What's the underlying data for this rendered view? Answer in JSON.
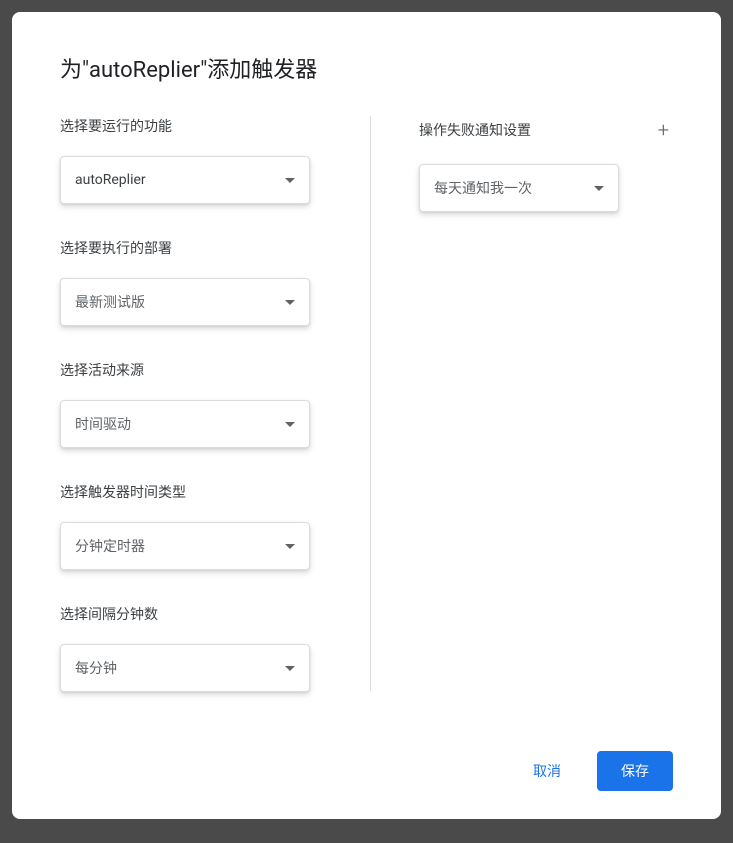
{
  "dialog": {
    "title": "为\"autoReplier\"添加触发器"
  },
  "leftColumn": {
    "fields": [
      {
        "label": "选择要运行的功能",
        "value": "autoReplier",
        "dark": true
      },
      {
        "label": "选择要执行的部署",
        "value": "最新测试版",
        "dark": false
      },
      {
        "label": "选择活动来源",
        "value": "时间驱动",
        "dark": false
      },
      {
        "label": "选择触发器时间类型",
        "value": "分钟定时器",
        "dark": false
      },
      {
        "label": "选择间隔分钟数",
        "value": "每分钟",
        "dark": false
      }
    ]
  },
  "rightColumn": {
    "label": "操作失败通知设置",
    "select": {
      "value": "每天通知我一次"
    }
  },
  "footer": {
    "cancel": "取消",
    "save": "保存"
  }
}
